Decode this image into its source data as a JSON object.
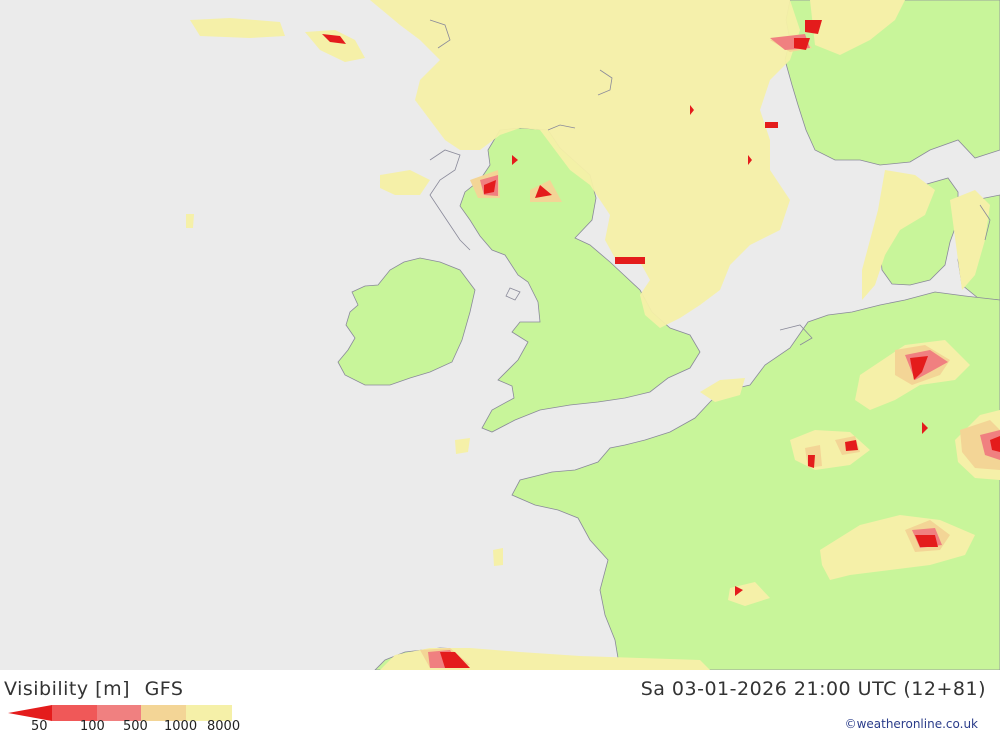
{
  "map": {
    "title": "Visibility [m]",
    "model": "GFS",
    "valid_time": "Sa 03-01-2026 21:00 UTC (12+81)",
    "credit": "©weatheronline.co.uk",
    "colors": {
      "sea": "#ebebeb",
      "land": "#c8f59a",
      "coast": "#8a8a9a",
      "vis_8000": "#f5f0a8",
      "vis_1000": "#f3d596",
      "vis_500": "#f08080",
      "vis_100": "#f05858",
      "vis_50": "#e41c1c"
    },
    "legend": {
      "labels": [
        "50",
        "100",
        "500",
        "1000",
        "8000"
      ]
    }
  }
}
